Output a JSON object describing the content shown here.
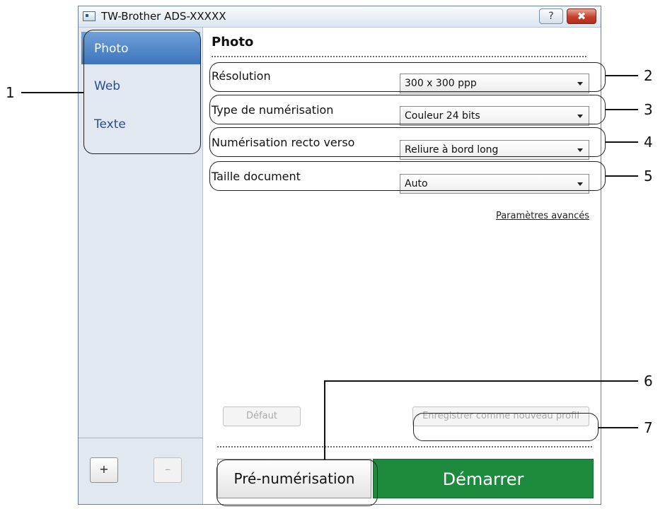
{
  "window": {
    "title": "TW-Brother ADS-XXXXX",
    "help_glyph": "?",
    "close_glyph": "✖"
  },
  "sidebar": {
    "items": [
      {
        "label": "Photo",
        "active": true
      },
      {
        "label": "Web",
        "active": false
      },
      {
        "label": "Texte",
        "active": false
      }
    ],
    "add_label": "+",
    "remove_label": "–"
  },
  "main": {
    "heading": "Photo",
    "settings": [
      {
        "label": "Résolution",
        "value": "300 x 300 ppp"
      },
      {
        "label": "Type de numérisation",
        "value": "Couleur 24 bits"
      },
      {
        "label": "Numérisation recto verso",
        "value": "Reliure à bord long"
      },
      {
        "label": "Taille document",
        "value": "Auto"
      }
    ],
    "advanced_link": "Paramètres avancés",
    "default_button": "Défaut",
    "save_profile_button": "Enregistrer comme nouveau profil",
    "prescan_button": "Pré-numérisation",
    "start_button": "Démarrer"
  },
  "callouts": [
    "1",
    "2",
    "3",
    "4",
    "5",
    "6",
    "7"
  ],
  "colors": {
    "start": "#1d8a3e",
    "sidebar_active": "#3c74bd",
    "sidebar_text": "#2d4c93"
  }
}
